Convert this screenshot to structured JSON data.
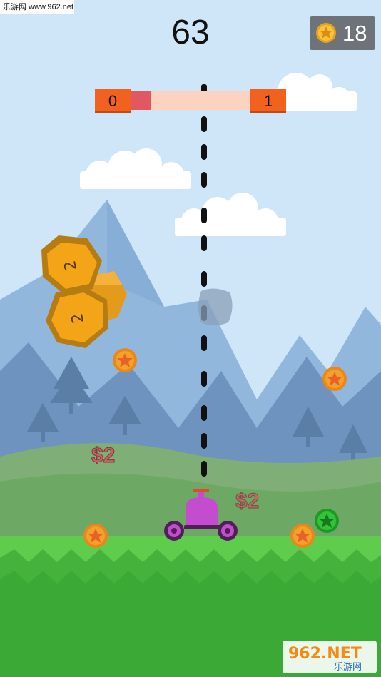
{
  "watermark": {
    "site_text": "乐游网 www.962.net",
    "logo_text": "962.NET",
    "logo_sub": "乐游网"
  },
  "hud": {
    "score": "63",
    "coins": "18"
  },
  "level_bar": {
    "current_level": "0",
    "next_level": "1",
    "progress": 0.17
  },
  "coin_rocks": [
    {
      "value": "2"
    },
    {
      "value": "2"
    }
  ],
  "floating_rewards": [
    "$2",
    "$2"
  ],
  "colors": {
    "sky": "#cfe6f8",
    "grass": "#3aa935",
    "accent_orange": "#f2621e",
    "cannon": "#c34ccf",
    "coin_gold": "#f4a12a",
    "coin_green": "#32c23c"
  },
  "icons": [
    "star-coin-icon",
    "cannon-icon",
    "bullet-icon",
    "cloud-icon",
    "tree-icon"
  ]
}
